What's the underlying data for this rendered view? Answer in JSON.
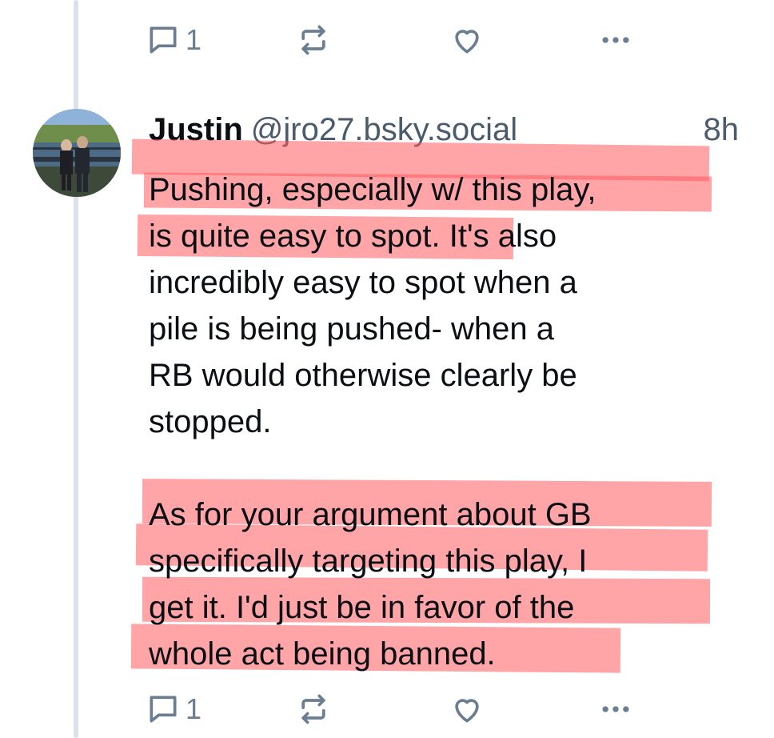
{
  "thread": {
    "top_actions": {
      "reply_count": "1"
    },
    "post": {
      "author_name": "Justin",
      "author_handle": "@jro27.bsky.social",
      "timestamp": "8h",
      "paragraph1_lines": [
        "Pushing, especially w/ this play,",
        "is quite easy to spot. It's also",
        "incredibly easy to spot when a",
        "pile is being pushed- when a",
        "RB would otherwise clearly be",
        "stopped."
      ],
      "paragraph2_lines": [
        "As for your argument about GB",
        "specifically targeting this play, I",
        "get it. I'd just be in favor of the",
        "whole act being banned."
      ],
      "actions": {
        "reply_count": "1"
      }
    }
  },
  "icons": {
    "reply": "speech-bubble-icon",
    "repost": "repost-arrows-icon",
    "like": "heart-icon",
    "more": "ellipsis-icon"
  },
  "colors": {
    "highlight": "#ff5a5f",
    "icon_gray": "#6b7e91",
    "thread_line": "#d9e1ea"
  }
}
